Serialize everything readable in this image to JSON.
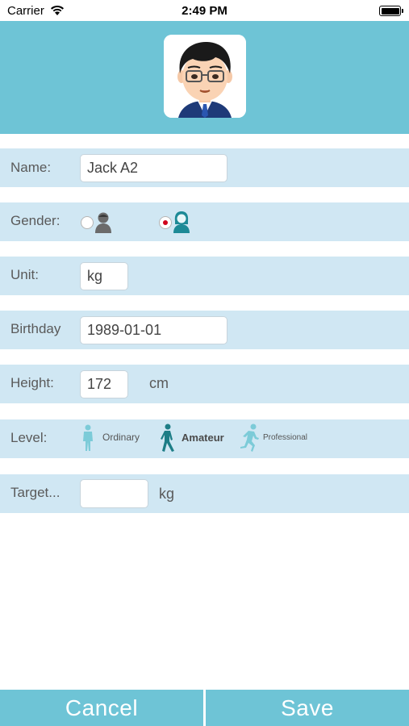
{
  "status_bar": {
    "carrier": "Carrier",
    "time": "2:49 PM"
  },
  "form": {
    "name": {
      "label": "Name:",
      "value": "Jack A2"
    },
    "gender": {
      "label": "Gender:",
      "selected": "female",
      "options": [
        "male",
        "female"
      ]
    },
    "unit": {
      "label": "Unit:",
      "value": "kg"
    },
    "birthday": {
      "label": "Birthday",
      "value": "1989-01-01"
    },
    "height": {
      "label": "Height:",
      "value": "172",
      "unit": "cm"
    },
    "level": {
      "label": "Level:",
      "options": [
        {
          "label": "Ordinary",
          "icon": "standing-person-icon"
        },
        {
          "label": "Amateur",
          "icon": "walking-person-icon"
        },
        {
          "label": "Professional",
          "icon": "running-person-icon"
        }
      ],
      "selected": "Amateur"
    },
    "target": {
      "label": "Target...",
      "value": "",
      "unit": "kg"
    }
  },
  "actions": {
    "cancel_label": "Cancel",
    "save_label": "Save"
  },
  "colors": {
    "header": "#6ec4d6",
    "row": "#d0e7f3",
    "selected_icon": "#1d8a96",
    "unselected_icon": "#7ccbd8",
    "radio_selected": "#d0021b"
  }
}
